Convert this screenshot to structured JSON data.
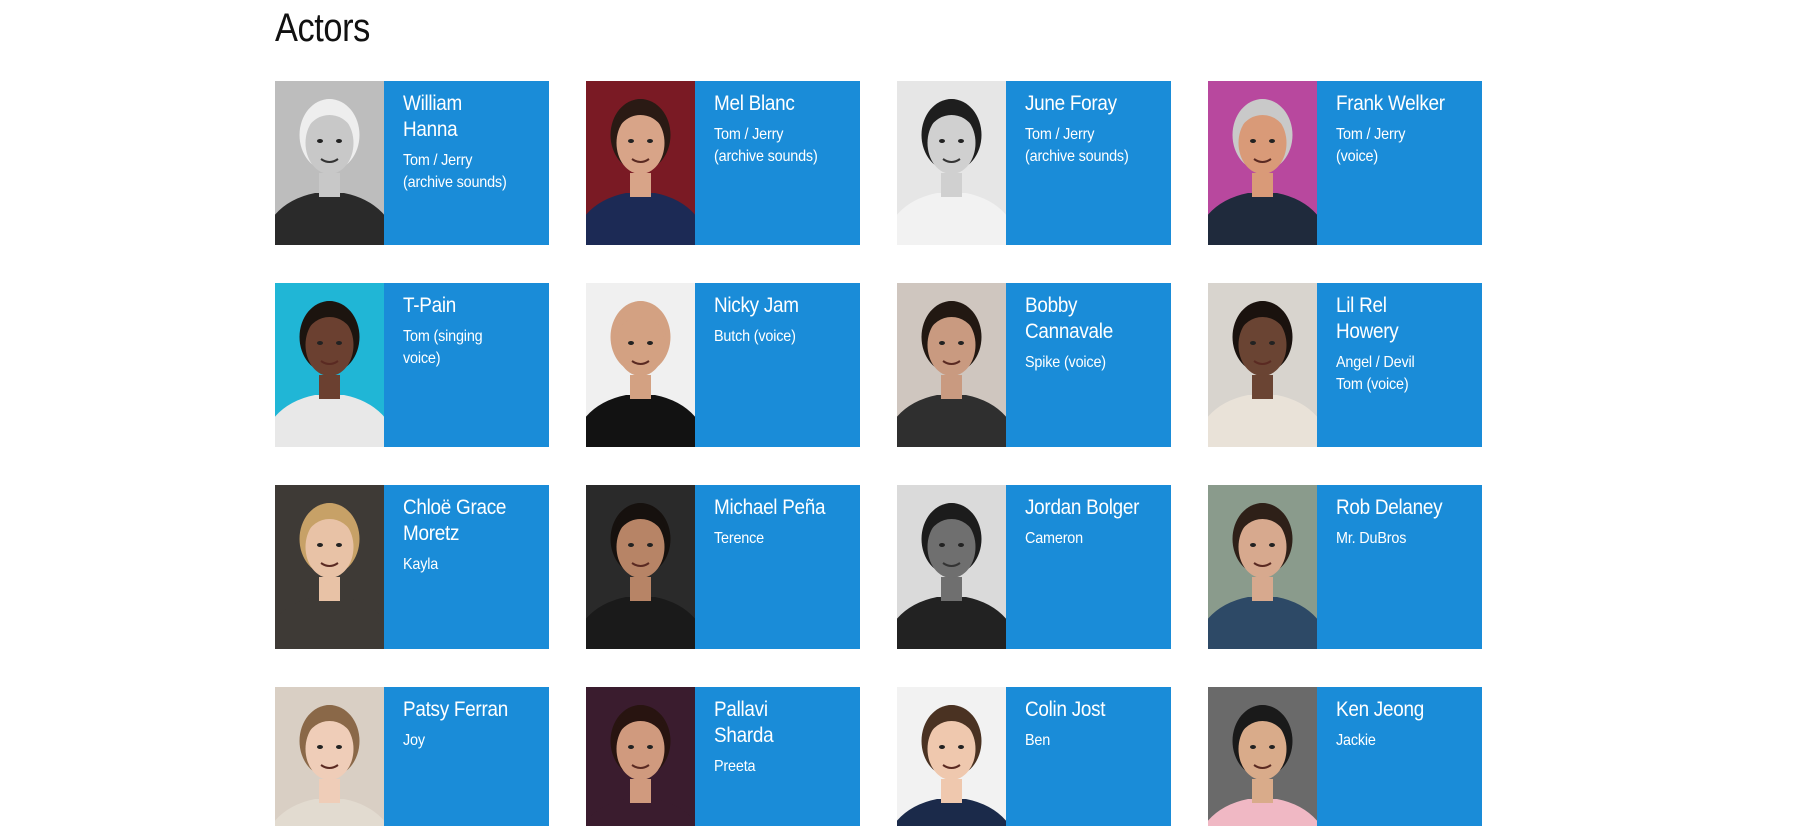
{
  "section": {
    "title": "Actors"
  },
  "actors": [
    {
      "name": "William\nHanna",
      "role": "Tom / Jerry\n(archive sounds)",
      "photo": {
        "bg": "#bdbdbd",
        "skin": "#c8c8c8",
        "hair": "#eeeeee",
        "suit": "#2a2a2a",
        "mono": true
      }
    },
    {
      "name": "Mel Blanc",
      "role": "Tom / Jerry\n(archive sounds)",
      "photo": {
        "bg": "#7a1a24",
        "skin": "#d8a488",
        "hair": "#2a1a14",
        "suit": "#1c2a55",
        "mono": false
      }
    },
    {
      "name": "June Foray",
      "role": "Tom / Jerry\n(archive sounds)",
      "photo": {
        "bg": "#e6e6e6",
        "skin": "#d0d0d0",
        "hair": "#1e1e1e",
        "suit": "#f2f2f2",
        "mono": true
      }
    },
    {
      "name": "Frank Welker",
      "role": "Tom / Jerry\n(voice)",
      "photo": {
        "bg": "#b8489e",
        "skin": "#d99a78",
        "hair": "#c9c9c9",
        "suit": "#1f2a3c",
        "mono": false
      }
    },
    {
      "name": "T-Pain",
      "role": "Tom (singing\nvoice)",
      "photo": {
        "bg": "#20b6d6",
        "skin": "#6b4030",
        "hair": "#1c140f",
        "suit": "#e8e8e8",
        "mono": false
      }
    },
    {
      "name": "Nicky Jam",
      "role": "Butch (voice)",
      "photo": {
        "bg": "#f0f0f0",
        "skin": "#d3a182",
        "hair": "#d3a182",
        "suit": "#121212",
        "mono": false
      }
    },
    {
      "name": "Bobby\nCannavale",
      "role": "Spike (voice)",
      "photo": {
        "bg": "#cfc6bf",
        "skin": "#c99a80",
        "hair": "#221812",
        "suit": "#2f2f2f",
        "mono": false
      }
    },
    {
      "name": "Lil Rel\nHowery",
      "role": "Angel / Devil\nTom (voice)",
      "photo": {
        "bg": "#d8d4ce",
        "skin": "#6a4433",
        "hair": "#1a120e",
        "suit": "#e9e2d8",
        "mono": false
      }
    },
    {
      "name": "Chloë Grace\nMoretz",
      "role": "Kayla",
      "photo": {
        "bg": "#3e3a36",
        "skin": "#e8c2a6",
        "hair": "#c7a167",
        "suit": "#3e3a36",
        "mono": false
      }
    },
    {
      "name": "Michael Peña",
      "role": "Terence",
      "photo": {
        "bg": "#2a2a2a",
        "skin": "#b78466",
        "hair": "#16110e",
        "suit": "#1a1a1a",
        "mono": false
      }
    },
    {
      "name": "Jordan Bolger",
      "role": "Cameron",
      "photo": {
        "bg": "#dadada",
        "skin": "#6f6f6f",
        "hair": "#1c1c1c",
        "suit": "#222222",
        "mono": true
      }
    },
    {
      "name": "Rob Delaney",
      "role": "Mr. DuBros",
      "photo": {
        "bg": "#8a9b8c",
        "skin": "#d7a98e",
        "hair": "#2e2018",
        "suit": "#2d4966",
        "mono": false
      }
    },
    {
      "name": "Patsy Ferran",
      "role": "Joy",
      "photo": {
        "bg": "#d9cfc4",
        "skin": "#efcdb8",
        "hair": "#8a6848",
        "suit": "#e2dbd0",
        "mono": false
      }
    },
    {
      "name": "Pallavi\nSharda",
      "role": "Preeta",
      "photo": {
        "bg": "#3a1c2e",
        "skin": "#d09a7e",
        "hair": "#281410",
        "suit": "#3a1c2e",
        "mono": false
      }
    },
    {
      "name": "Colin Jost",
      "role": "Ben",
      "photo": {
        "bg": "#f2f2f2",
        "skin": "#efc8ae",
        "hair": "#4a3222",
        "suit": "#1b2a4a",
        "mono": false
      }
    },
    {
      "name": "Ken Jeong",
      "role": "Jackie",
      "photo": {
        "bg": "#6a6a6a",
        "skin": "#d9ab8a",
        "hair": "#1a1a1a",
        "suit": "#f0b8c4",
        "mono": false
      }
    }
  ]
}
